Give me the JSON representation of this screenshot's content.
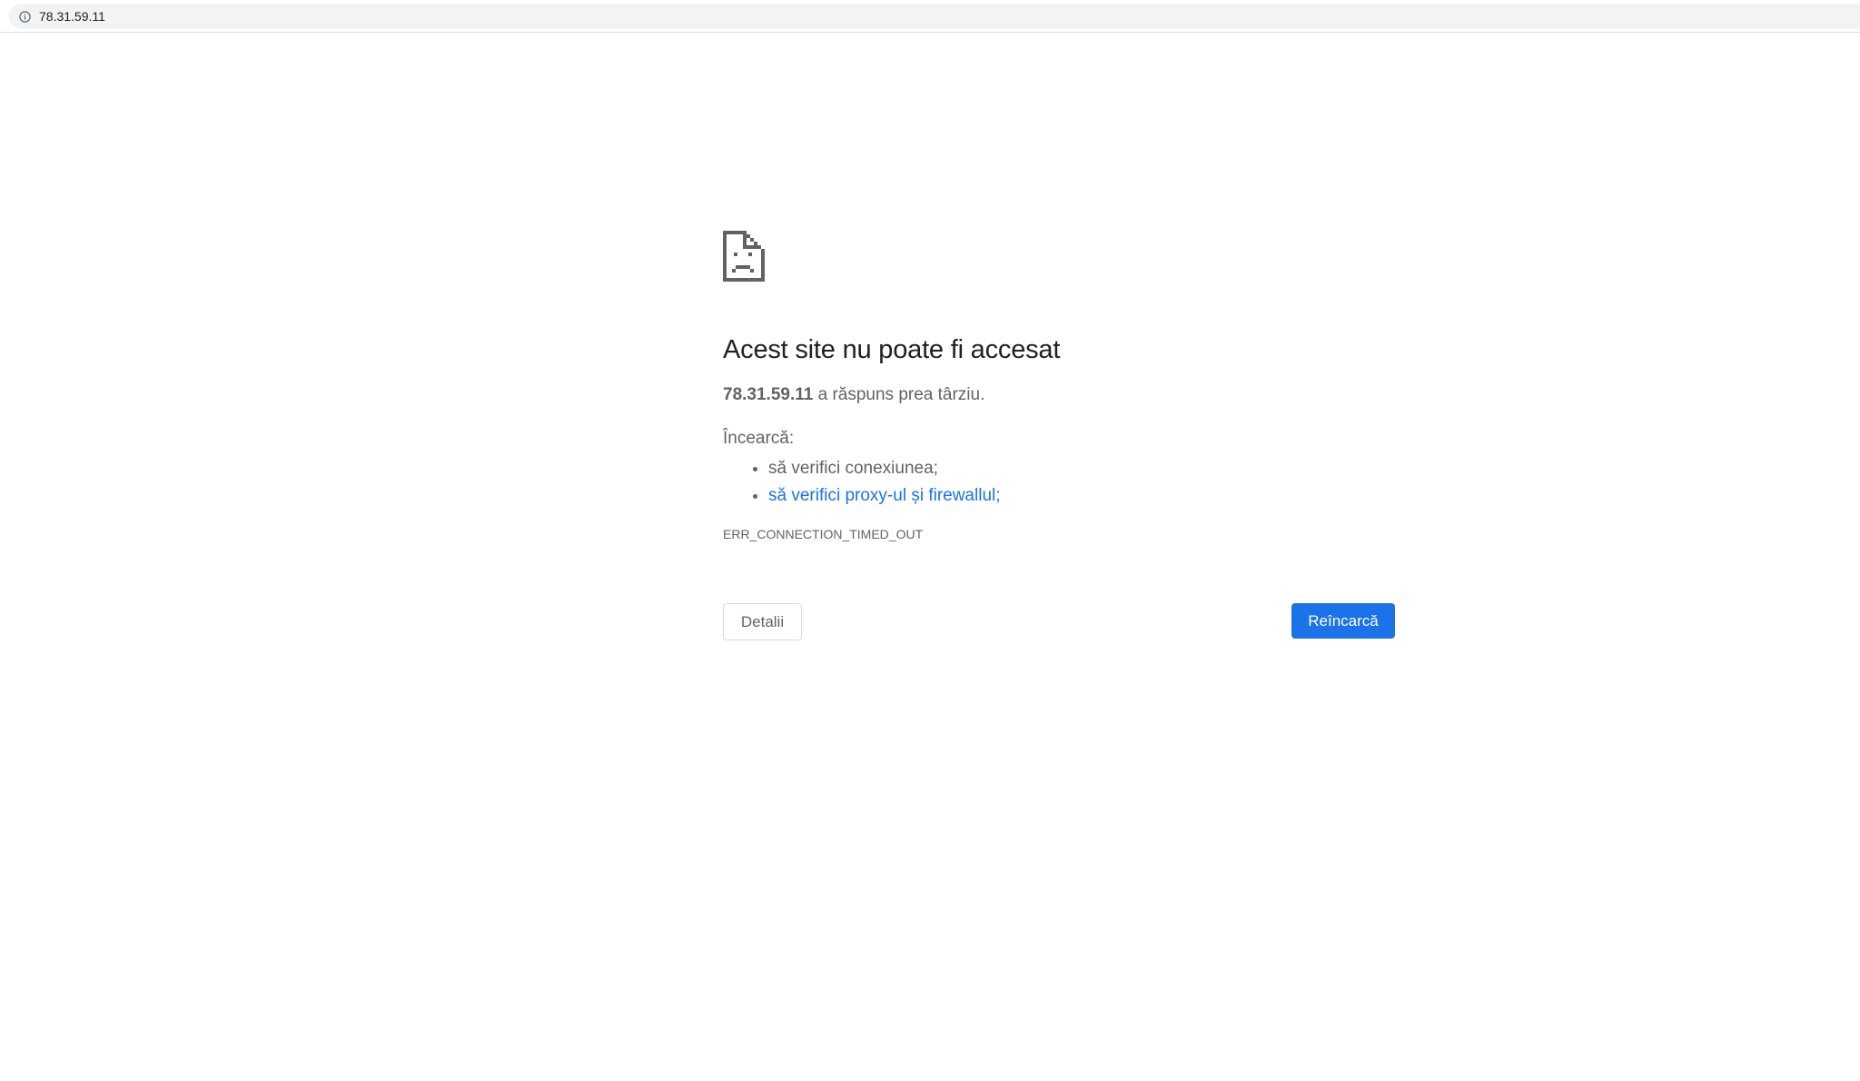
{
  "address_bar": {
    "url": "78.31.59.11",
    "icon": "info-icon"
  },
  "error_page": {
    "icon": "sad-page-icon",
    "title": "Acest site nu poate fi accesat",
    "summary_host": "78.31.59.11",
    "summary_text": " a răspuns prea târziu.",
    "suggestions_label": "Încearcă:",
    "suggestions": [
      {
        "label": "să verifici conexiunea;",
        "is_link": false
      },
      {
        "label": "să verifici proxy-ul și firewallul;",
        "is_link": true
      }
    ],
    "error_code": "ERR_CONNECTION_TIMED_OUT",
    "details_label": "Detalii",
    "reload_label": "Reîncarcă"
  },
  "colors": {
    "link": "#1a73e8",
    "primary_button": "#1a73e8",
    "text_secondary": "#5f6368",
    "omnibox_bg": "#f1f3f4"
  }
}
